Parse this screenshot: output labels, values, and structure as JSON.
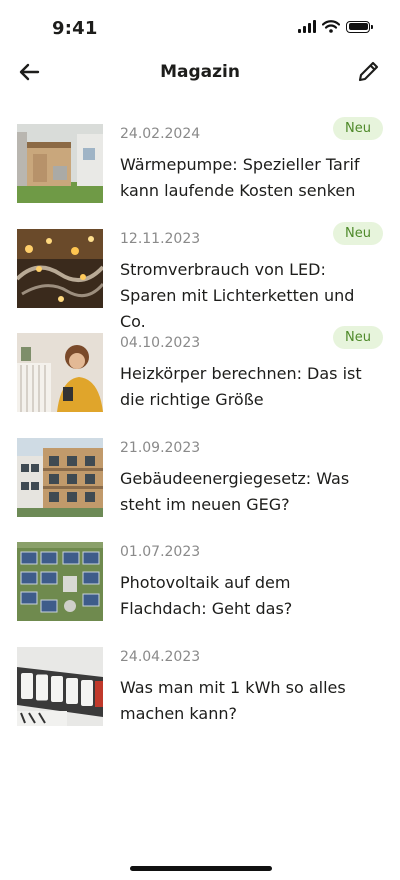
{
  "status_bar": {
    "time": "9:41"
  },
  "header": {
    "title": "Magazin",
    "back_icon": "arrow-left-icon",
    "edit_icon": "pencil-icon"
  },
  "articles": [
    {
      "date": "24.02.2024",
      "title": "Wärmepumpe: Spezieller Tarif kann laufende Kosten senken",
      "badge": "Neu",
      "image": "heat-pump-house-image"
    },
    {
      "date": "12.11.2023",
      "title": "Stromverbrauch von LED: Sparen mit Lichterketten und Co.",
      "badge": "Neu",
      "image": "fairy-lights-image"
    },
    {
      "date": "04.10.2023",
      "title": "Heizkörper berechnen: Das ist die richtige Größe",
      "badge": "Neu",
      "image": "woman-radiator-image"
    },
    {
      "date": "21.09.2023",
      "title": "Gebäudeenergiegesetz: Was steht im neuen GEG?",
      "badge": "",
      "image": "apartment-building-image"
    },
    {
      "date": "01.07.2023",
      "title": "Photovoltaik auf dem Flachdach: Geht das?",
      "badge": "",
      "image": "solar-panels-image"
    },
    {
      "date": "24.04.2023",
      "title": "Was man mit 1 kWh so alles machen kann?",
      "badge": "",
      "image": "electricity-meter-image"
    }
  ],
  "colors": {
    "badge_bg": "#e7f4dc",
    "badge_text": "#4f8a2a",
    "date_text": "#8a8a8a",
    "title_text": "#1d1d1b"
  }
}
